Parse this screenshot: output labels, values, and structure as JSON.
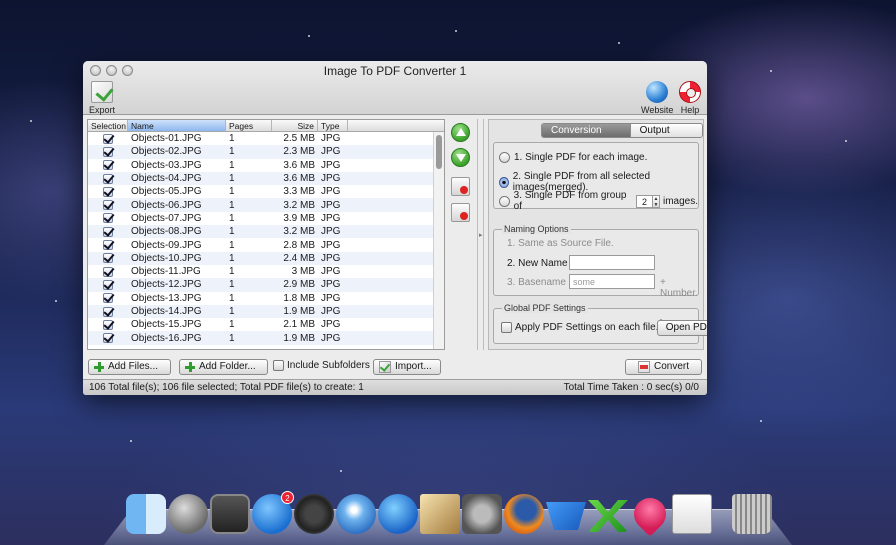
{
  "window": {
    "title": "Image To PDF Converter 1"
  },
  "toolbar": {
    "export_label": "Export",
    "website_label": "Website",
    "help_label": "Help"
  },
  "table": {
    "headers": [
      "Selection",
      "Name",
      "Pages",
      "Size",
      "Type"
    ],
    "rows": [
      {
        "name": "Objects-01.JPG",
        "pages": "1",
        "size": "2.5 MB",
        "type": "JPG"
      },
      {
        "name": "Objects-02.JPG",
        "pages": "1",
        "size": "2.3 MB",
        "type": "JPG"
      },
      {
        "name": "Objects-03.JPG",
        "pages": "1",
        "size": "3.6 MB",
        "type": "JPG"
      },
      {
        "name": "Objects-04.JPG",
        "pages": "1",
        "size": "3.6 MB",
        "type": "JPG"
      },
      {
        "name": "Objects-05.JPG",
        "pages": "1",
        "size": "3.3 MB",
        "type": "JPG"
      },
      {
        "name": "Objects-06.JPG",
        "pages": "1",
        "size": "3.2 MB",
        "type": "JPG"
      },
      {
        "name": "Objects-07.JPG",
        "pages": "1",
        "size": "3.9 MB",
        "type": "JPG"
      },
      {
        "name": "Objects-08.JPG",
        "pages": "1",
        "size": "3.2 MB",
        "type": "JPG"
      },
      {
        "name": "Objects-09.JPG",
        "pages": "1",
        "size": "2.8 MB",
        "type": "JPG"
      },
      {
        "name": "Objects-10.JPG",
        "pages": "1",
        "size": "2.4 MB",
        "type": "JPG"
      },
      {
        "name": "Objects-11.JPG",
        "pages": "1",
        "size": "3 MB",
        "type": "JPG"
      },
      {
        "name": "Objects-12.JPG",
        "pages": "1",
        "size": "2.9 MB",
        "type": "JPG"
      },
      {
        "name": "Objects-13.JPG",
        "pages": "1",
        "size": "1.8 MB",
        "type": "JPG"
      },
      {
        "name": "Objects-14.JPG",
        "pages": "1",
        "size": "1.9 MB",
        "type": "JPG"
      },
      {
        "name": "Objects-15.JPG",
        "pages": "1",
        "size": "2.1 MB",
        "type": "JPG"
      },
      {
        "name": "Objects-16.JPG",
        "pages": "1",
        "size": "1.9 MB",
        "type": "JPG"
      }
    ]
  },
  "tabs": {
    "conversion": "Conversion Options",
    "output": "Output Options"
  },
  "conversion": {
    "option1": "1. Single PDF for each image.",
    "option2": "2. Single PDF from all selected images(merged).",
    "option3_prefix": "3. Single PDF from group of",
    "option3_value": "2",
    "option3_suffix": "images."
  },
  "naming": {
    "title": "Naming Options",
    "same_as_source": "1. Same as Source File.",
    "new_name": "2. New Name",
    "new_name_value": "",
    "basename": "3. Basename",
    "basename_placeholder": "some",
    "number_suffix": "+ Number."
  },
  "global": {
    "title": "Global PDF Settings",
    "apply_label": "Apply PDF Settings on each file.",
    "open_button": "Open PDF Settings..."
  },
  "bottom": {
    "add_files": "Add Files...",
    "add_folder": "Add Folder...",
    "include_subfolders": "Include Subfolders",
    "import": "Import...",
    "convert": "Convert"
  },
  "status": {
    "left": "106 Total file(s); 106 file selected; Total PDF file(s) to create: 1",
    "right": "Total Time Taken : 0 sec(s) 0/0"
  },
  "dock": {
    "appstore_badge": "2",
    "icons": [
      "finder-icon",
      "launchpad-icon",
      "mission-control-icon",
      "app-store-icon",
      "dashboard-icon",
      "safari-icon",
      "itunes-icon",
      "iphoto-icon",
      "system-preferences-icon",
      "firefox-icon",
      "word-icon",
      "excel-icon",
      "heart-app-icon",
      "pdf-app-icon",
      "trash-icon"
    ]
  }
}
